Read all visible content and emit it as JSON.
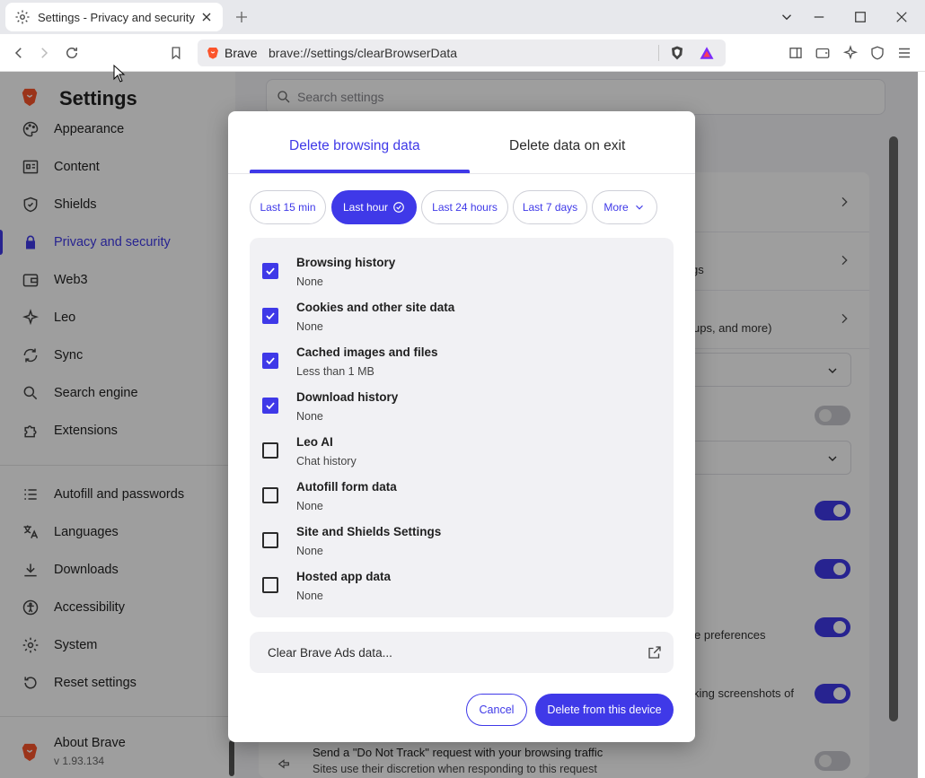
{
  "browser": {
    "tab_title": "Settings - Privacy and security",
    "omnibox_brand": "Brave",
    "url": "brave://settings/clearBrowserData"
  },
  "settings": {
    "title": "Settings",
    "search_placeholder": "Search settings",
    "sidebar_items": [
      {
        "label": "Appearance",
        "icon": "palette-icon"
      },
      {
        "label": "Content",
        "icon": "content-icon"
      },
      {
        "label": "Shields",
        "icon": "shield-icon"
      },
      {
        "label": "Privacy and security",
        "icon": "lock-icon",
        "active": true
      },
      {
        "label": "Web3",
        "icon": "wallet-icon"
      },
      {
        "label": "Leo",
        "icon": "leo-icon"
      },
      {
        "label": "Sync",
        "icon": "sync-icon"
      },
      {
        "label": "Search engine",
        "icon": "search-icon"
      },
      {
        "label": "Extensions",
        "icon": "puzzle-icon"
      },
      {
        "label": "Autofill and passwords",
        "icon": "list-icon"
      },
      {
        "label": "Languages",
        "icon": "translate-icon"
      },
      {
        "label": "Downloads",
        "icon": "download-icon"
      },
      {
        "label": "Accessibility",
        "icon": "accessibility-icon"
      },
      {
        "label": "System",
        "icon": "gear-icon"
      },
      {
        "label": "Reset settings",
        "icon": "reset-icon"
      }
    ],
    "about_title": "About Brave",
    "about_version": "v 1.93.134",
    "background_fragments": {
      "row2_tail": "gs",
      "row3_tail": "ups, and more)",
      "row_pref_tail": "e preferences",
      "row_screens_tail": "king screenshots of",
      "dnt_title": "Send a \"Do Not Track\" request with your browsing traffic",
      "dnt_sub": "Sites use their discretion when responding to this request"
    }
  },
  "dialog": {
    "tabs": [
      {
        "label": "Delete browsing data",
        "active": true
      },
      {
        "label": "Delete data on exit",
        "active": false
      }
    ],
    "time_ranges": [
      {
        "label": "Last 15 min",
        "selected": false
      },
      {
        "label": "Last hour",
        "selected": true
      },
      {
        "label": "Last 24 hours",
        "selected": false
      },
      {
        "label": "Last 7 days",
        "selected": false
      },
      {
        "label": "More",
        "selected": false
      }
    ],
    "items": [
      {
        "title": "Browsing history",
        "subtitle": "None",
        "checked": true
      },
      {
        "title": "Cookies and other site data",
        "subtitle": "None",
        "checked": true
      },
      {
        "title": "Cached images and files",
        "subtitle": "Less than 1 MB",
        "checked": true
      },
      {
        "title": "Download history",
        "subtitle": "None",
        "checked": true
      },
      {
        "title": "Leo AI",
        "subtitle": "Chat history",
        "checked": false
      },
      {
        "title": "Autofill form data",
        "subtitle": "None",
        "checked": false
      },
      {
        "title": "Site and Shields Settings",
        "subtitle": "None",
        "checked": false
      },
      {
        "title": "Hosted app data",
        "subtitle": "None",
        "checked": false
      }
    ],
    "clear_ads_label": "Clear Brave Ads data...",
    "cancel_label": "Cancel",
    "delete_label": "Delete from this device"
  },
  "colors": {
    "accent": "#3f39e8"
  }
}
